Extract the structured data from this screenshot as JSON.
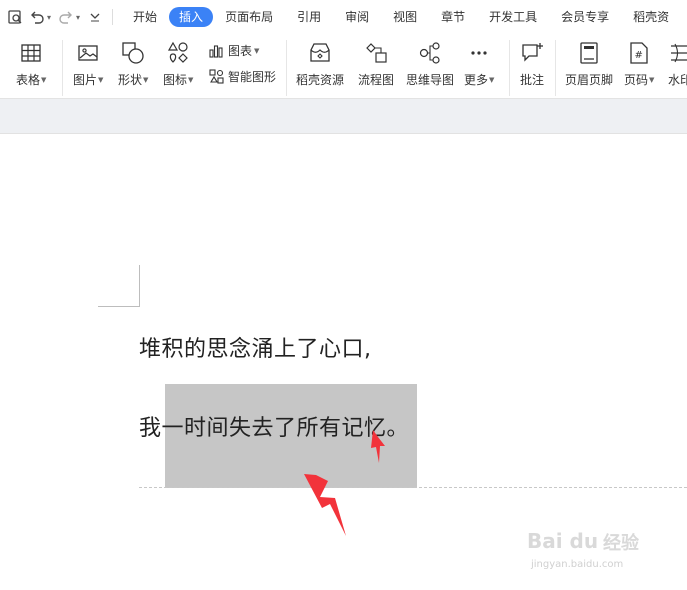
{
  "tabs": [
    "开始",
    "插入",
    "页面布局",
    "引用",
    "审阅",
    "视图",
    "章节",
    "开发工具",
    "会员专享",
    "稻壳资"
  ],
  "active_tab": "插入",
  "ribbon": {
    "table": "表格",
    "picture": "图片",
    "shape": "形状",
    "icon": "图标",
    "chart": "图表",
    "smart_graphic": "智能图形",
    "docer_resources": "稻壳资源",
    "flowchart": "流程图",
    "mindmap": "思维导图",
    "more": "更多",
    "comment": "批注",
    "header_footer": "页眉页脚",
    "page_number": "页码",
    "watermark": "水印"
  },
  "document": {
    "line1": "堆积的思念涌上了心口,",
    "line2": "我一时间失去了所有记忆。"
  },
  "overlay_watermark": {
    "brand": "Bai du",
    "brand_cn": "经验",
    "url": "jingyan.baidu.com"
  },
  "colors": {
    "active_tab": "#3b82f6",
    "selection": "#c6c6c6",
    "arrow": "#f2333b"
  }
}
